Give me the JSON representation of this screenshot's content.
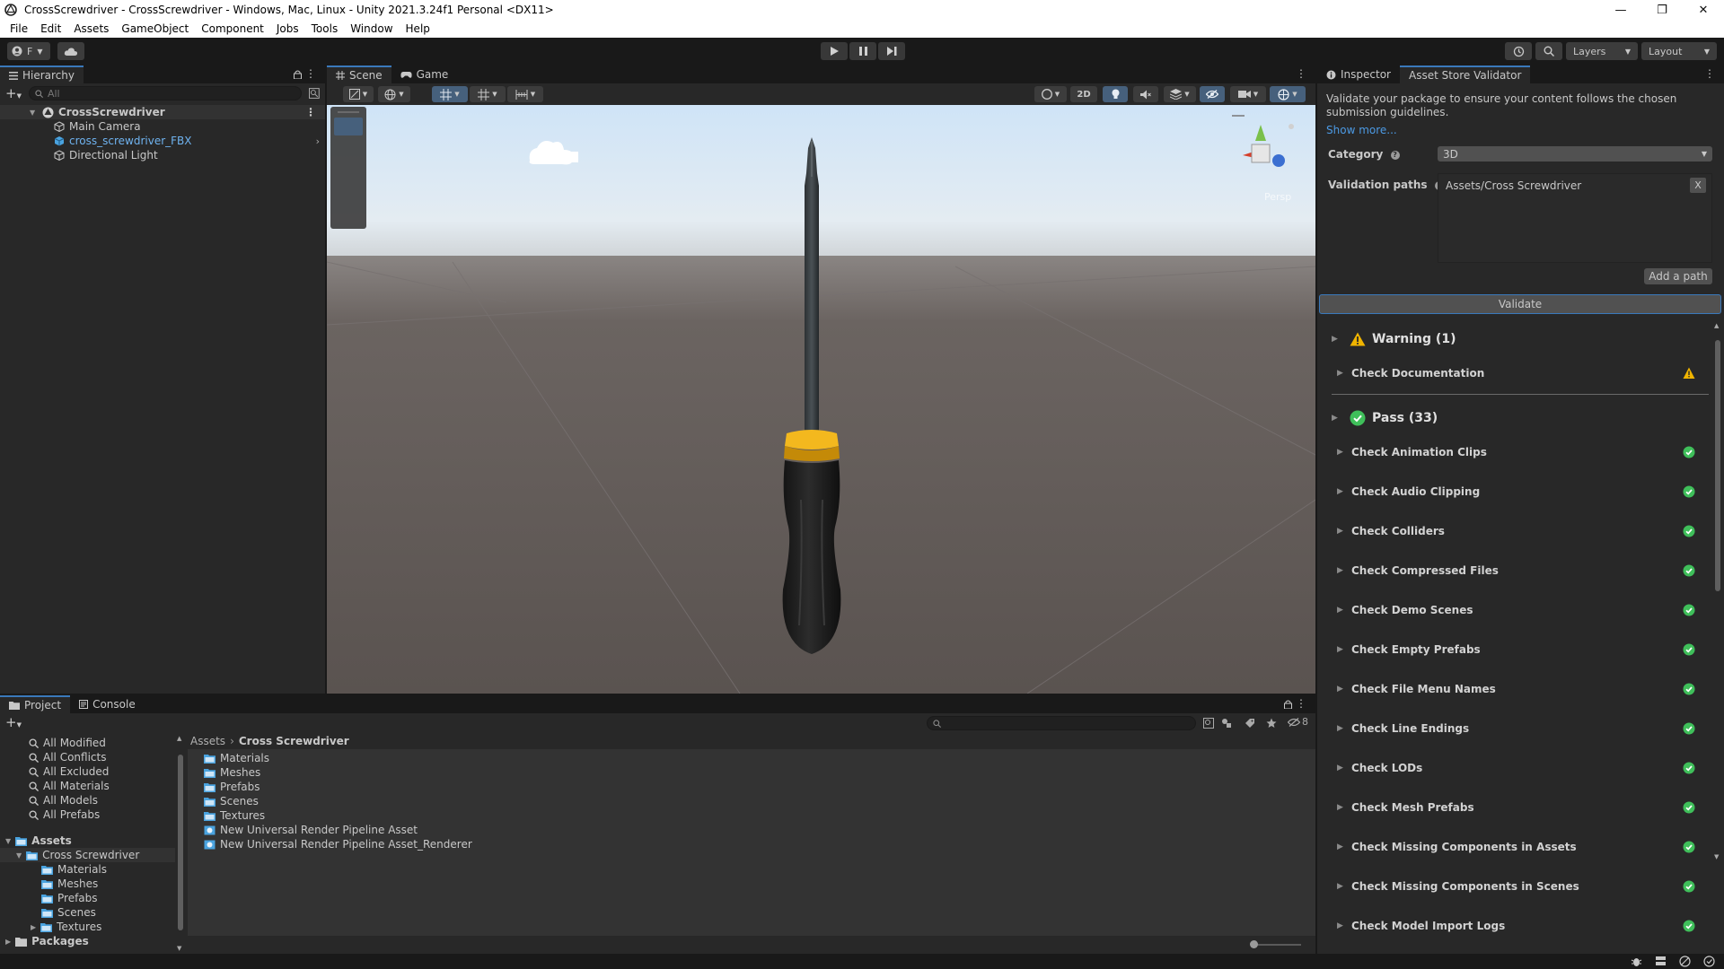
{
  "window": {
    "title": "CrossScrewdriver - CrossScrewdriver - Windows, Mac, Linux - Unity 2021.3.24f1 Personal <DX11>"
  },
  "menu": [
    "File",
    "Edit",
    "Assets",
    "GameObject",
    "Component",
    "Jobs",
    "Tools",
    "Window",
    "Help"
  ],
  "toolbar": {
    "account_label": "F",
    "layers_label": "Layers",
    "layout_label": "Layout"
  },
  "hierarchy": {
    "tab_label": "Hierarchy",
    "search_placeholder": "All",
    "scene_name": "CrossScrewdriver",
    "items": [
      "Main Camera",
      "cross_screwdriver_FBX",
      "Directional Light"
    ]
  },
  "scene": {
    "tabs": [
      "Scene",
      "Game"
    ],
    "mode_2d_label": "2D",
    "persp_label": "Persp"
  },
  "inspector": {
    "tabs": [
      "Inspector",
      "Asset Store Validator"
    ],
    "description": "Validate your package to ensure your content follows the chosen submission guidelines.",
    "show_more": "Show more...",
    "category_label": "Category",
    "category_value": "3D",
    "validation_paths_label": "Validation paths",
    "validation_path": "Assets/Cross Screwdriver",
    "remove_path_label": "X",
    "add_path_label": "Add a path",
    "validate_label": "Validate",
    "warning_group": "Warning (1)",
    "warning_items": [
      "Check Documentation"
    ],
    "pass_group": "Pass (33)",
    "pass_items": [
      "Check Animation Clips",
      "Check Audio Clipping",
      "Check Colliders",
      "Check Compressed Files",
      "Check Demo Scenes",
      "Check Empty Prefabs",
      "Check File Menu Names",
      "Check Line Endings",
      "Check LODs",
      "Check Mesh Prefabs",
      "Check Missing Components in Assets",
      "Check Missing Components in Scenes",
      "Check Model Import Logs"
    ]
  },
  "project": {
    "tabs": [
      "Project",
      "Console"
    ],
    "favorites": [
      "All Modified",
      "All Conflicts",
      "All Excluded",
      "All Materials",
      "All Models",
      "All Prefabs"
    ],
    "tree_root": "Assets",
    "tree_selected": "Cross Screwdriver",
    "tree_children": [
      "Materials",
      "Meshes",
      "Prefabs",
      "Scenes",
      "Textures"
    ],
    "tree_packages": "Packages",
    "breadcrumb": [
      "Assets",
      "Cross Screwdriver"
    ],
    "content_folders": [
      "Materials",
      "Meshes",
      "Prefabs",
      "Scenes",
      "Textures"
    ],
    "content_assets": [
      "New Universal Render Pipeline Asset",
      "New Universal Render Pipeline Asset_Renderer"
    ],
    "hidden_count": "8"
  },
  "colors": {
    "accent": "#3a79bb",
    "pass": "#3fbf5a",
    "warning": "#f0b400",
    "handle_yellow": "#f3b81e"
  }
}
